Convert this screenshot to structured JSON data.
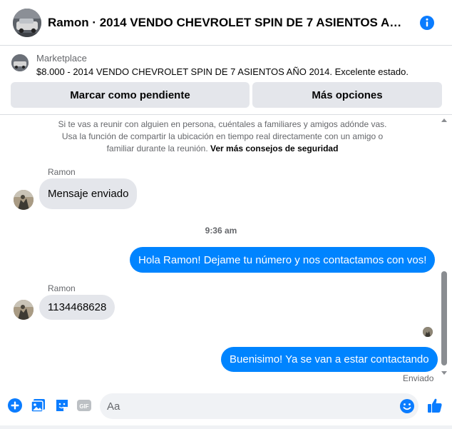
{
  "header": {
    "title": "Ramon · 2014 VENDO CHEVROLET SPIN DE 7 ASIENTOS AÑO 2014. Excelente estado.",
    "info_icon": "info-icon"
  },
  "marketplace": {
    "label": "Marketplace",
    "description": "$8.000 - 2014 VENDO CHEVROLET SPIN DE 7 ASIENTOS AÑO 2014. Excelente estado.",
    "buttons": {
      "pending": "Marcar como pendiente",
      "more": "Más opciones"
    }
  },
  "safety": {
    "text": "Si te vas a reunir con alguien en persona, cuéntales a familiares y amigos adónde vas. Usa la función de compartir la ubicación en tiempo real directamente con un amigo o familiar durante la reunión.",
    "link": "Ver más consejos de seguridad"
  },
  "messages": [
    {
      "sender": "Ramon",
      "text": "Mensaje enviado",
      "direction": "in"
    },
    {
      "timestamp": "9:36 am"
    },
    {
      "text": "Hola Ramon! Dejame tu número y nos contactamos con vos!",
      "direction": "out"
    },
    {
      "sender": "Ramon",
      "text": "1134468628",
      "direction": "in"
    },
    {
      "text": "Buenisimo! Ya se van a estar contactando",
      "direction": "out",
      "status": "Enviado"
    }
  ],
  "composer": {
    "placeholder": "Aa",
    "icons": [
      "plus-icon",
      "photo-icon",
      "sticker-icon",
      "gif-icon",
      "emoji-icon",
      "like-icon"
    ],
    "gif_label": "GIF"
  },
  "colors": {
    "accent": "#0084ff",
    "icon_blue": "#0a7cff",
    "bubble_in": "#e4e6eb",
    "secondary_text": "#65676b"
  }
}
